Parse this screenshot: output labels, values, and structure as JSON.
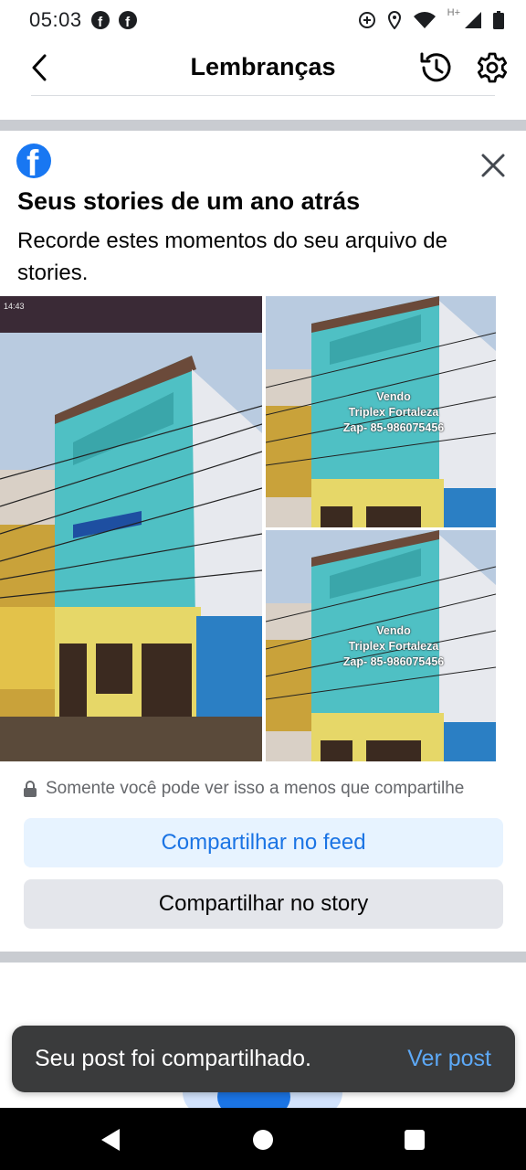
{
  "status_bar": {
    "time": "05:03",
    "network_label": "H+",
    "notification_icons": [
      "facebook-icon",
      "facebook-icon"
    ],
    "system_icons": [
      "data-saver-icon",
      "location-icon",
      "wifi-icon",
      "signal-icon",
      "battery-icon"
    ]
  },
  "header": {
    "title": "Lembranças",
    "back_icon": "back-arrow-icon",
    "history_icon": "history-clock-icon",
    "settings_icon": "gear-icon"
  },
  "memory_card": {
    "logo": "f",
    "title": "Seus stories de um ano atrás",
    "subtitle": "Recorde estes momentos do seu arquivo de stories.",
    "photos": [
      {
        "time_label": "14:43",
        "caption": []
      },
      {
        "caption": [
          "Vendo",
          "Triplex Fortaleza",
          "Zap- 85-986075456"
        ]
      },
      {
        "caption": [
          "Vendo",
          "Triplex Fortaleza",
          "Zap- 85-986075456"
        ]
      }
    ],
    "privacy_note": "Somente você pode ver isso a menos que compartilhe",
    "share_feed_label": "Compartilhar no feed",
    "share_story_label": "Compartilhar no story"
  },
  "snackbar": {
    "message": "Seu post foi compartilhado.",
    "action_label": "Ver post"
  },
  "colors": {
    "facebook_blue": "#1877f2",
    "feed_button_bg": "#e7f3ff",
    "story_button_bg": "#e4e6eb",
    "snackbar_bg": "#3a3b3c",
    "snackbar_action": "#5da9f7"
  }
}
